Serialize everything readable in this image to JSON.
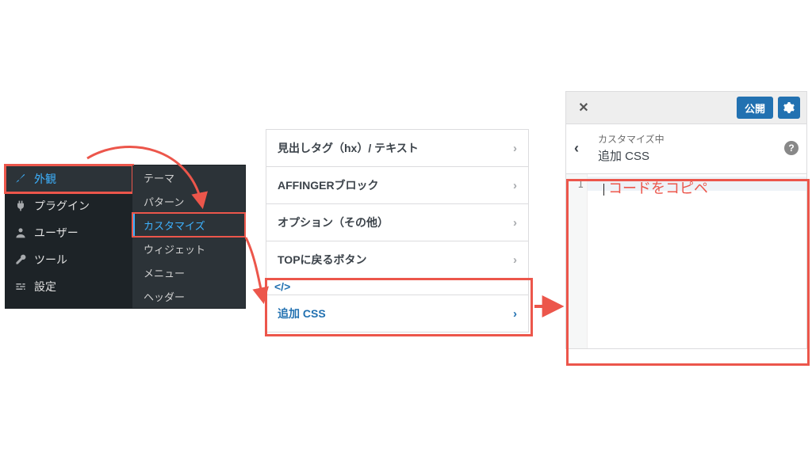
{
  "sidebar": {
    "items": [
      {
        "label": "外観",
        "icon": "brush"
      },
      {
        "label": "プラグイン",
        "icon": "plug"
      },
      {
        "label": "ユーザー",
        "icon": "user"
      },
      {
        "label": "ツール",
        "icon": "wrench"
      },
      {
        "label": "設定",
        "icon": "sliders"
      }
    ],
    "submenu": [
      "テーマ",
      "パターン",
      "カスタマイズ",
      "ウィジェット",
      "メニュー",
      "ヘッダー"
    ],
    "active_item_index": 0,
    "active_submenu_index": 2
  },
  "customizer_list": {
    "rows": [
      "見出しタグ（hx）/ テキスト",
      "AFFINGERブロック",
      "オプション（その他）",
      "TOPに戻るボタン"
    ],
    "css_section_code_icon": "</>",
    "css_row": "追加 CSS"
  },
  "editor_panel": {
    "close_glyph": "✕",
    "publish": "公開",
    "breadcrumb": "カスタマイズ中",
    "title": "追加 CSS",
    "help_glyph": "?",
    "line_number": "1",
    "placeholder_annotation": "コードをコピペ"
  },
  "annotation_color": "#EC564B"
}
